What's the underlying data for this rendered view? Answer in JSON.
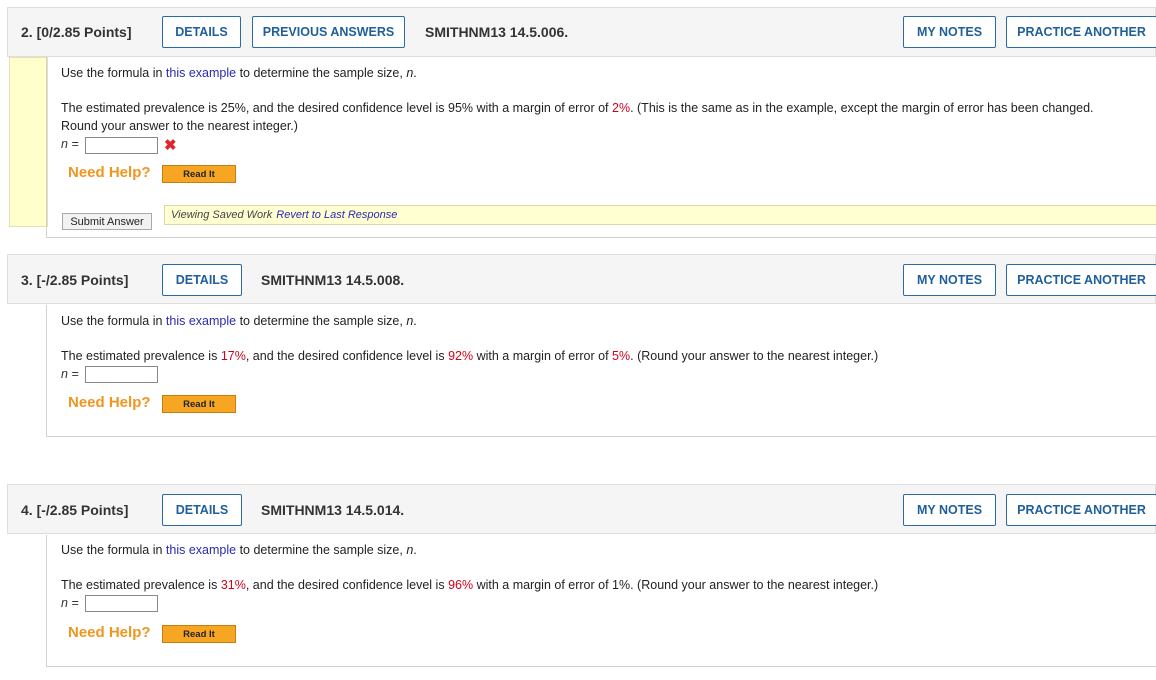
{
  "questions": [
    {
      "title": "2.  [0/2.85 Points]",
      "details": "DETAILS",
      "previous_answers": "PREVIOUS ANSWERS",
      "id": "SMITHNM13 14.5.006.",
      "my_notes": "MY NOTES",
      "practice_another": "PRACTICE ANOTHER",
      "prompt_pre": "Use the formula in ",
      "prompt_link": "this example",
      "prompt_post": " to determine the sample size, ",
      "prompt_var": "n",
      "prompt_end": ".",
      "problem_pre": "The estimated prevalence is 25%, and the desired confidence level is 95% with a margin of error of ",
      "problem_red": "2%",
      "problem_post": ". (This is the same as in the example, except the margin of error has been changed. Round your answer to the nearest integer.)",
      "n_label": "n =",
      "n_value": "",
      "incorrect_icon": "x-mark-icon",
      "need_help": "Need Help?",
      "read_it": "Read It",
      "submit": "Submit Answer",
      "saved_text": "Viewing Saved Work",
      "revert": "Revert to Last Response"
    },
    {
      "title": "3.  [-/2.85 Points]",
      "details": "DETAILS",
      "id": "SMITHNM13 14.5.008.",
      "my_notes": "MY NOTES",
      "practice_another": "PRACTICE ANOTHER",
      "prompt_pre": "Use the formula in ",
      "prompt_link": "this example",
      "prompt_post": " to determine the sample size, ",
      "prompt_var": "n",
      "prompt_end": ".",
      "problem_a": "The estimated prevalence is ",
      "problem_b": "17%",
      "problem_c": ", and the desired confidence level is ",
      "problem_d": "92%",
      "problem_e": " with a margin of error of ",
      "problem_f": "5%",
      "problem_g": ". (Round your answer to the nearest integer.)",
      "n_label": "n =",
      "n_value": "",
      "need_help": "Need Help?",
      "read_it": "Read It"
    },
    {
      "title": "4.  [-/2.85 Points]",
      "details": "DETAILS",
      "id": "SMITHNM13 14.5.014.",
      "my_notes": "MY NOTES",
      "practice_another": "PRACTICE ANOTHER",
      "prompt_pre": "Use the formula in ",
      "prompt_link": "this example",
      "prompt_post": " to determine the sample size, ",
      "prompt_var": "n",
      "prompt_end": ".",
      "problem_a": "The estimated prevalence is ",
      "problem_b": "31%",
      "problem_c": ", and the desired confidence level is ",
      "problem_d": "96%",
      "problem_e": " with a margin of error of 1%. (Round your answer to the nearest integer.)",
      "n_label": "n =",
      "n_value": "",
      "need_help": "Need Help?",
      "read_it": "Read It"
    }
  ],
  "colors": {
    "accent_blue": "#1f5f9b",
    "red_value": "#d0021b",
    "need_help_orange": "#f0961f",
    "read_it_orange": "#f6a623",
    "incorrect_bar": "#ffffcc"
  }
}
